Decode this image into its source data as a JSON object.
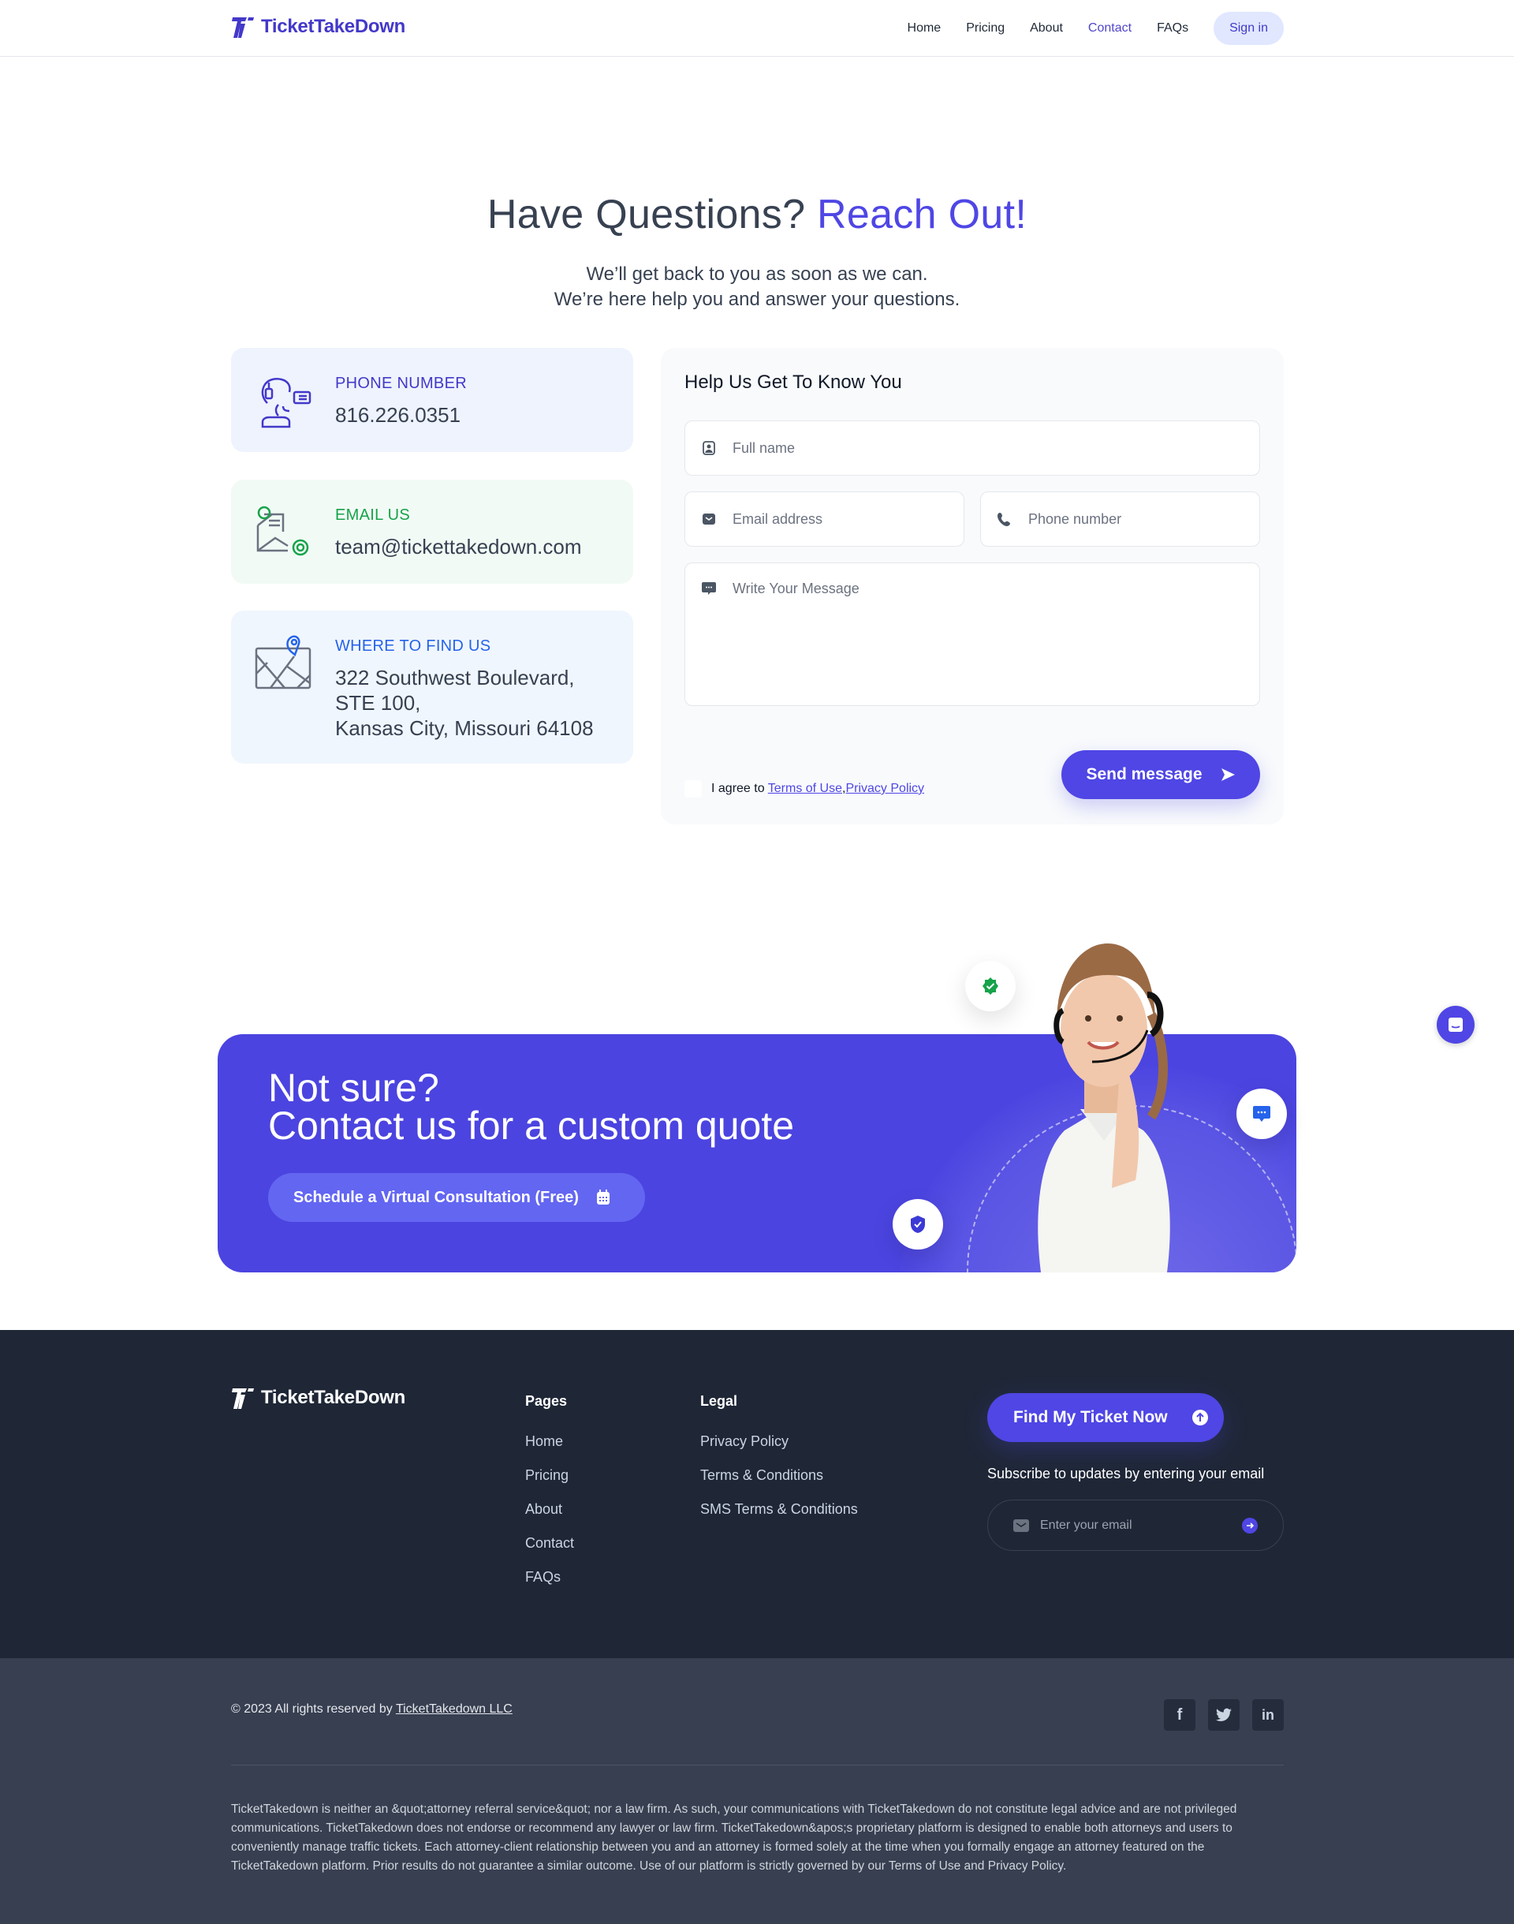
{
  "nav": {
    "brand": "TicketTakeDown",
    "links": [
      "Home",
      "Pricing",
      "About",
      "Contact",
      "FAQs"
    ],
    "active": "Contact",
    "signin_label": "Sign in"
  },
  "hero": {
    "title": "Have Questions?",
    "title_accent": "Reach Out!",
    "subtitle_line1": "We’ll get back to you as soon as we can.",
    "subtitle_line2": "We’re here help you and answer your questions."
  },
  "contact_cards": {
    "phone": {
      "label": "PHONE NUMBER",
      "value": "816.226.0351"
    },
    "email": {
      "label": "EMAIL US",
      "value": "team@tickettakedown.com"
    },
    "address": {
      "label": "WHERE TO FIND US",
      "line1": "322 Southwest Boulevard,",
      "line2": "STE 100,",
      "line3": "Kansas City, Missouri 64108"
    }
  },
  "form": {
    "title": "Help Us Get To Know You",
    "fullname_placeholder": "Full name",
    "email_placeholder": "Email address",
    "phone_placeholder": "Phone number",
    "message_placeholder": "Write Your Message",
    "agree_prefix": "I agree to",
    "terms_link": "Terms of Use",
    "separator": ",",
    "privacy_link": "Privacy Policy",
    "agree_checked": false,
    "send_label": "Send message"
  },
  "cta": {
    "line1": "Not sure?",
    "line2": "Contact us for a custom quote",
    "schedule_label": "Schedule a Virtual Consultation (Free)"
  },
  "footer": {
    "brand": "TicketTakeDown",
    "pages_heading": "Pages",
    "pages": [
      "Home",
      "Pricing",
      "About",
      "Contact",
      "FAQs"
    ],
    "legal_heading": "Legal",
    "legal": [
      "Privacy Policy",
      "Terms & Conditions",
      "SMS Terms & Conditions"
    ],
    "find_label": "Find My Ticket Now",
    "subscribe_label": "Subscribe to updates by entering your email",
    "subscribe_placeholder": "Enter your email",
    "copyright_prefix": "© 2023 All rights reserved by",
    "copyright_link": "TicketTakedown LLC",
    "socials": [
      "facebook",
      "twitter",
      "linkedin"
    ],
    "disclaimer": "TicketTakedown is neither an &quot;attorney referral service&quot; nor a law firm. As such, your communications with TicketTakedown do not constitute legal advice and are not privileged communications. TicketTakedown does not endorse or recommend any lawyer or law firm. TicketTakedown&apos;s proprietary platform is designed to enable both attorneys and users to conveniently manage traffic tickets. Each attorney-client relationship between you and an attorney is formed solely at the time when you formally engage an attorney featured on the TicketTakedown platform. Prior results do not guarantee a similar outcome. Use of our platform is strictly governed by our Terms of Use and Privacy Policy."
  },
  "colors": {
    "brand": "#4f46e5",
    "footer_bg": "#1f2737",
    "bottom_bg": "#373f51",
    "email_accent": "#16a34a",
    "address_accent": "#2563eb"
  }
}
